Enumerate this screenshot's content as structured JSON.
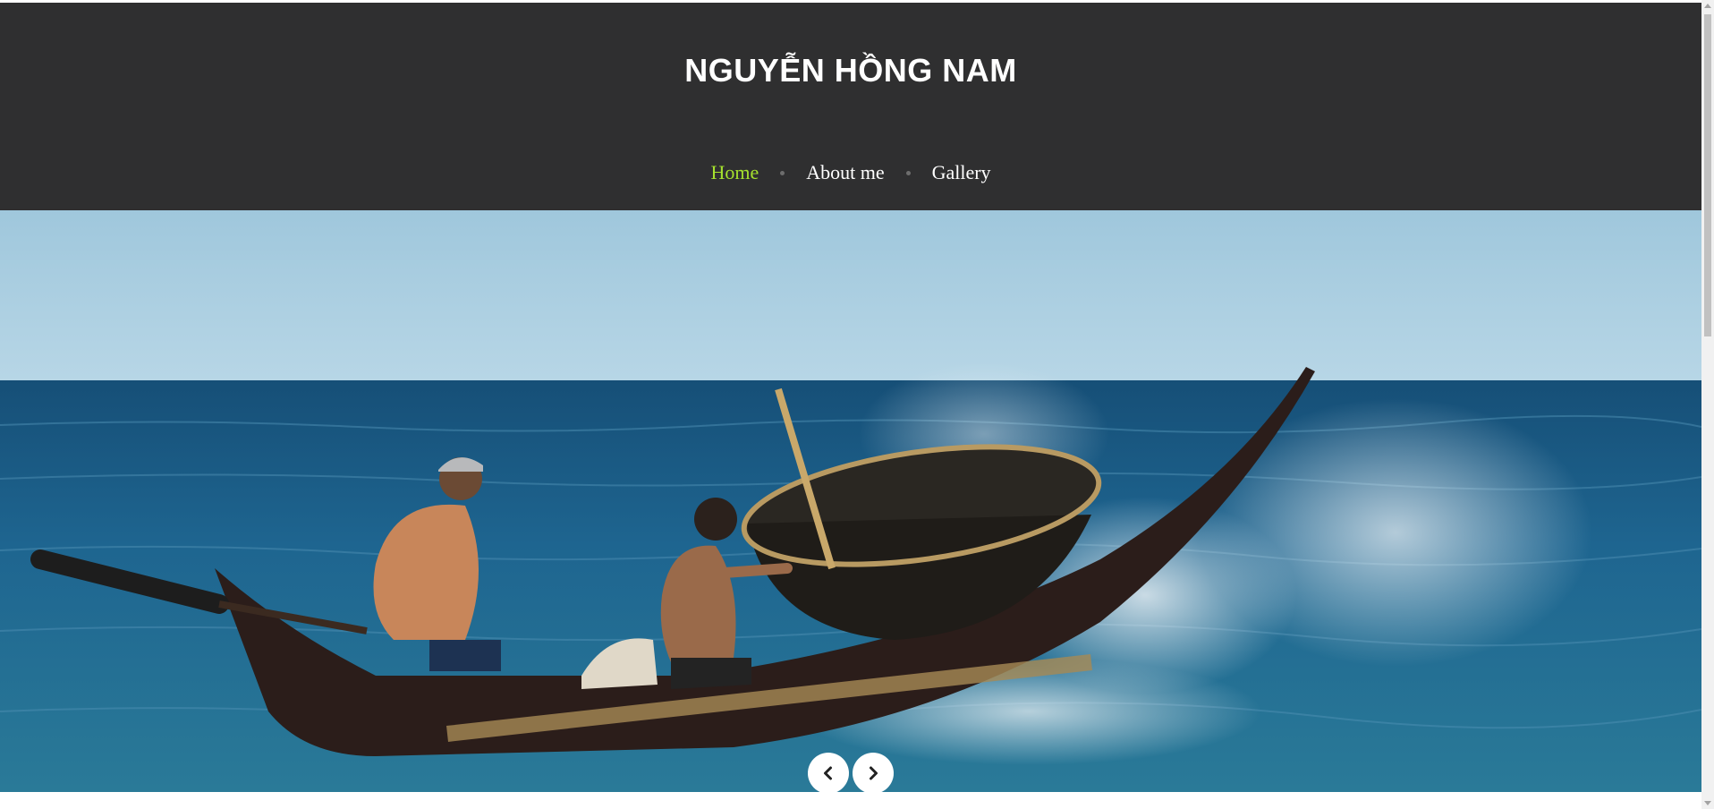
{
  "site": {
    "title": "NGUYỄN HỒNG NAM"
  },
  "nav": {
    "items": [
      {
        "label": "Home",
        "active": true
      },
      {
        "label": "About me",
        "active": false
      },
      {
        "label": "Gallery",
        "active": false
      }
    ]
  },
  "slider": {
    "image": "fishermen-boat-photo",
    "prev_icon": "chevron-left-icon",
    "next_icon": "chevron-right-icon"
  },
  "colors": {
    "header_bg": "#2f2f30",
    "nav_active": "#a6e22e",
    "nav_text": "#ffffff",
    "sea": "#1f5f86",
    "sky": "#a9cde0"
  }
}
